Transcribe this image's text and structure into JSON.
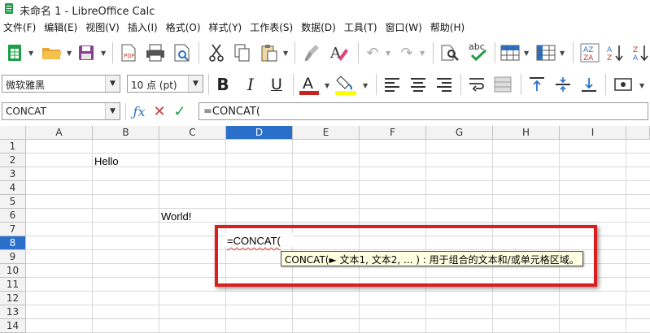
{
  "window": {
    "title": "未命名 1 - LibreOffice Calc"
  },
  "menu": [
    "文件(F)",
    "编辑(E)",
    "视图(V)",
    "插入(I)",
    "格式(O)",
    "样式(Y)",
    "工作表(S)",
    "数据(D)",
    "工具(T)",
    "窗口(W)",
    "帮助(H)"
  ],
  "toolbar2": {
    "font_name": "微软雅黑",
    "font_size": "10 点 (pt)"
  },
  "formula": {
    "name_box": "CONCAT",
    "content": "=CONCAT("
  },
  "columns": [
    "A",
    "B",
    "C",
    "D",
    "E",
    "F",
    "G",
    "H",
    "I"
  ],
  "rows": [
    "1",
    "2",
    "3",
    "4",
    "5",
    "6",
    "7",
    "8",
    "9",
    "10",
    "11",
    "12",
    "13",
    "14"
  ],
  "cells": {
    "B2": "Hello",
    "C6": "World!",
    "D8": "=CONCAT("
  },
  "tooltip": "CONCAT(► 文本1, 文本2, ... ) : 用于组合的文本和/或单元格区域。",
  "colors": {
    "selection": "#2a6fc9",
    "highlight": "#dd1c1c",
    "tooltip_bg": "#ffffe1",
    "app_green": "#1e9e47"
  }
}
